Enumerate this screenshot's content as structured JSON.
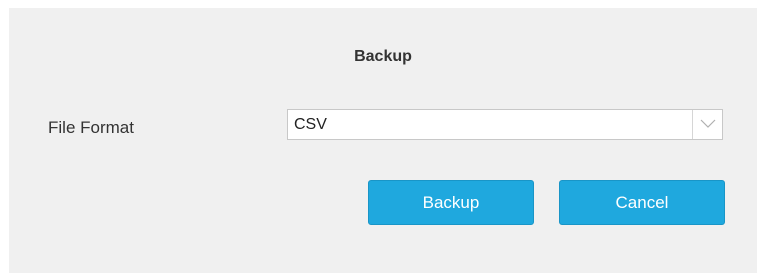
{
  "dialog": {
    "title": "Backup",
    "file_format": {
      "label": "File Format",
      "selected": "CSV"
    },
    "buttons": {
      "backup": "Backup",
      "cancel": "Cancel"
    }
  },
  "icons": {
    "dropdown": "chevron-down-icon"
  },
  "colors": {
    "button_bg": "#1fa8de",
    "dialog_bg": "#f0f0f0"
  }
}
